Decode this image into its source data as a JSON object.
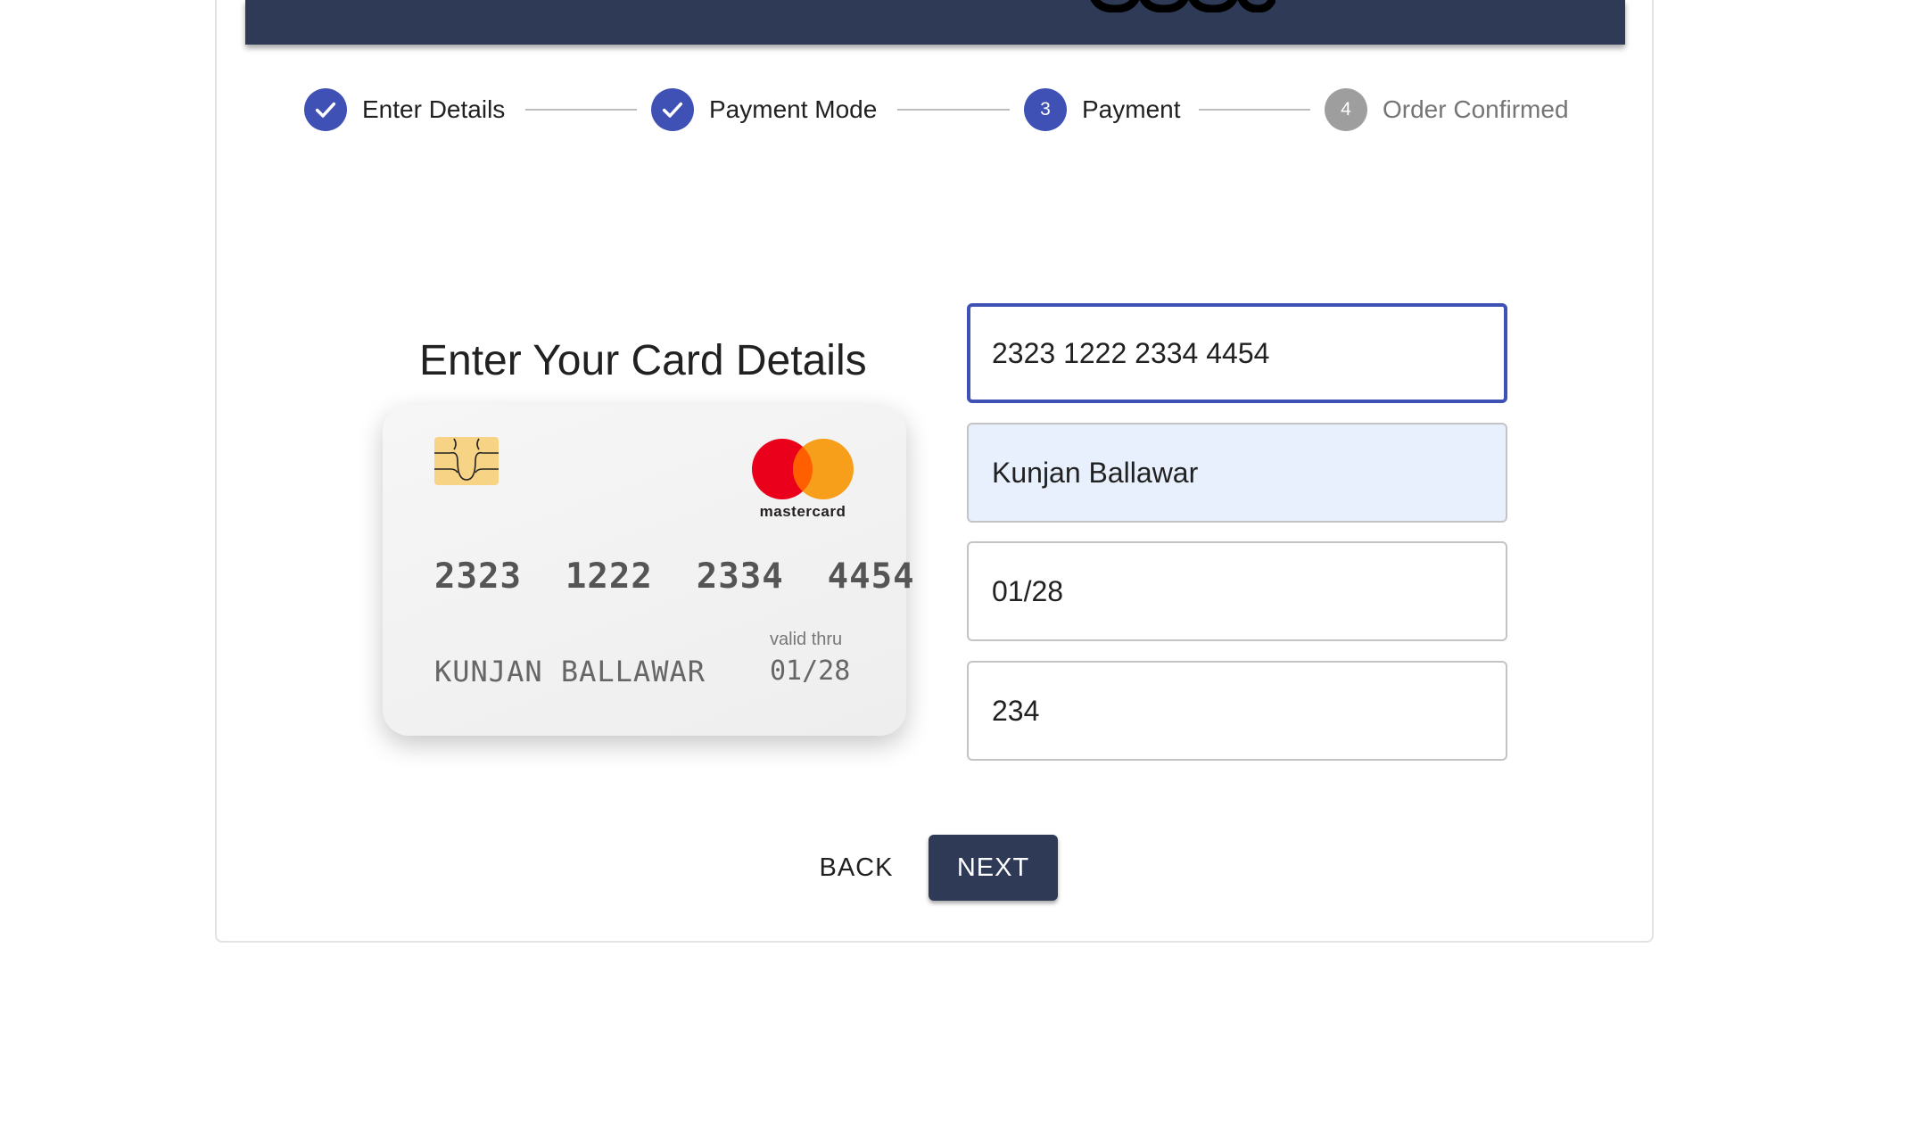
{
  "stepper": {
    "steps": [
      {
        "label": "Enter Details",
        "state": "completed",
        "icon": "check-icon"
      },
      {
        "label": "Payment Mode",
        "state": "completed",
        "icon": "check-icon"
      },
      {
        "label": "Payment",
        "state": "active",
        "number": "3"
      },
      {
        "label": "Order Confirmed",
        "state": "pending",
        "number": "4"
      }
    ]
  },
  "card_section": {
    "title": "Enter Your Card Details"
  },
  "card_preview": {
    "number": "2323  1222  2334  4454",
    "holder": "KUNJAN BALLAWAR",
    "valid_thru_label": "valid thru",
    "expiry": "01/28",
    "brand": "mastercard"
  },
  "form": {
    "card_number": "2323 1222 2334 4454",
    "card_name": "Kunjan Ballawar",
    "expiry": "01/28",
    "cvc": "234"
  },
  "actions": {
    "back_label": "BACK",
    "next_label": "NEXT"
  },
  "colors": {
    "primary": "#3f51b5",
    "header": "#2e3a56",
    "pending": "#9e9e9e",
    "autofill": "#e8f0fe"
  }
}
